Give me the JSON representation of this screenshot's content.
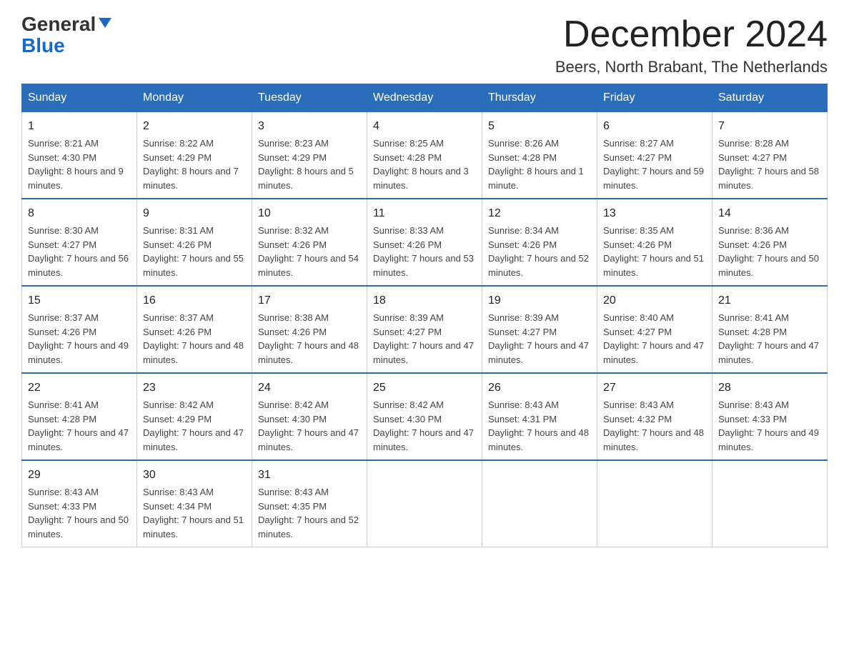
{
  "header": {
    "logo_general": "General",
    "logo_blue": "Blue",
    "title": "December 2024",
    "subtitle": "Beers, North Brabant, The Netherlands"
  },
  "days_of_week": [
    "Sunday",
    "Monday",
    "Tuesday",
    "Wednesday",
    "Thursday",
    "Friday",
    "Saturday"
  ],
  "weeks": [
    [
      {
        "day": "1",
        "sunrise": "8:21 AM",
        "sunset": "4:30 PM",
        "daylight": "8 hours and 9 minutes."
      },
      {
        "day": "2",
        "sunrise": "8:22 AM",
        "sunset": "4:29 PM",
        "daylight": "8 hours and 7 minutes."
      },
      {
        "day": "3",
        "sunrise": "8:23 AM",
        "sunset": "4:29 PM",
        "daylight": "8 hours and 5 minutes."
      },
      {
        "day": "4",
        "sunrise": "8:25 AM",
        "sunset": "4:28 PM",
        "daylight": "8 hours and 3 minutes."
      },
      {
        "day": "5",
        "sunrise": "8:26 AM",
        "sunset": "4:28 PM",
        "daylight": "8 hours and 1 minute."
      },
      {
        "day": "6",
        "sunrise": "8:27 AM",
        "sunset": "4:27 PM",
        "daylight": "7 hours and 59 minutes."
      },
      {
        "day": "7",
        "sunrise": "8:28 AM",
        "sunset": "4:27 PM",
        "daylight": "7 hours and 58 minutes."
      }
    ],
    [
      {
        "day": "8",
        "sunrise": "8:30 AM",
        "sunset": "4:27 PM",
        "daylight": "7 hours and 56 minutes."
      },
      {
        "day": "9",
        "sunrise": "8:31 AM",
        "sunset": "4:26 PM",
        "daylight": "7 hours and 55 minutes."
      },
      {
        "day": "10",
        "sunrise": "8:32 AM",
        "sunset": "4:26 PM",
        "daylight": "7 hours and 54 minutes."
      },
      {
        "day": "11",
        "sunrise": "8:33 AM",
        "sunset": "4:26 PM",
        "daylight": "7 hours and 53 minutes."
      },
      {
        "day": "12",
        "sunrise": "8:34 AM",
        "sunset": "4:26 PM",
        "daylight": "7 hours and 52 minutes."
      },
      {
        "day": "13",
        "sunrise": "8:35 AM",
        "sunset": "4:26 PM",
        "daylight": "7 hours and 51 minutes."
      },
      {
        "day": "14",
        "sunrise": "8:36 AM",
        "sunset": "4:26 PM",
        "daylight": "7 hours and 50 minutes."
      }
    ],
    [
      {
        "day": "15",
        "sunrise": "8:37 AM",
        "sunset": "4:26 PM",
        "daylight": "7 hours and 49 minutes."
      },
      {
        "day": "16",
        "sunrise": "8:37 AM",
        "sunset": "4:26 PM",
        "daylight": "7 hours and 48 minutes."
      },
      {
        "day": "17",
        "sunrise": "8:38 AM",
        "sunset": "4:26 PM",
        "daylight": "7 hours and 48 minutes."
      },
      {
        "day": "18",
        "sunrise": "8:39 AM",
        "sunset": "4:27 PM",
        "daylight": "7 hours and 47 minutes."
      },
      {
        "day": "19",
        "sunrise": "8:39 AM",
        "sunset": "4:27 PM",
        "daylight": "7 hours and 47 minutes."
      },
      {
        "day": "20",
        "sunrise": "8:40 AM",
        "sunset": "4:27 PM",
        "daylight": "7 hours and 47 minutes."
      },
      {
        "day": "21",
        "sunrise": "8:41 AM",
        "sunset": "4:28 PM",
        "daylight": "7 hours and 47 minutes."
      }
    ],
    [
      {
        "day": "22",
        "sunrise": "8:41 AM",
        "sunset": "4:28 PM",
        "daylight": "7 hours and 47 minutes."
      },
      {
        "day": "23",
        "sunrise": "8:42 AM",
        "sunset": "4:29 PM",
        "daylight": "7 hours and 47 minutes."
      },
      {
        "day": "24",
        "sunrise": "8:42 AM",
        "sunset": "4:30 PM",
        "daylight": "7 hours and 47 minutes."
      },
      {
        "day": "25",
        "sunrise": "8:42 AM",
        "sunset": "4:30 PM",
        "daylight": "7 hours and 47 minutes."
      },
      {
        "day": "26",
        "sunrise": "8:43 AM",
        "sunset": "4:31 PM",
        "daylight": "7 hours and 48 minutes."
      },
      {
        "day": "27",
        "sunrise": "8:43 AM",
        "sunset": "4:32 PM",
        "daylight": "7 hours and 48 minutes."
      },
      {
        "day": "28",
        "sunrise": "8:43 AM",
        "sunset": "4:33 PM",
        "daylight": "7 hours and 49 minutes."
      }
    ],
    [
      {
        "day": "29",
        "sunrise": "8:43 AM",
        "sunset": "4:33 PM",
        "daylight": "7 hours and 50 minutes."
      },
      {
        "day": "30",
        "sunrise": "8:43 AM",
        "sunset": "4:34 PM",
        "daylight": "7 hours and 51 minutes."
      },
      {
        "day": "31",
        "sunrise": "8:43 AM",
        "sunset": "4:35 PM",
        "daylight": "7 hours and 52 minutes."
      },
      null,
      null,
      null,
      null
    ]
  ],
  "labels": {
    "sunrise": "Sunrise:",
    "sunset": "Sunset:",
    "daylight": "Daylight:"
  }
}
